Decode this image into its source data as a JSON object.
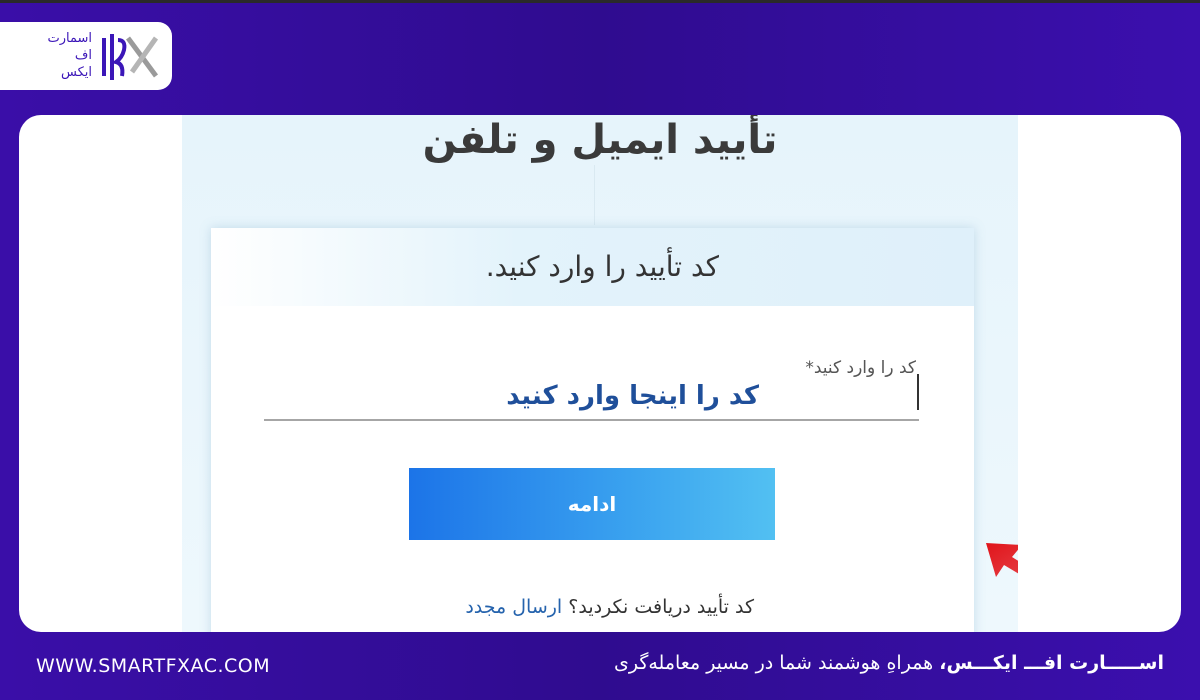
{
  "brand": {
    "logo_lines": [
      "اسمارت",
      "اف",
      "ایکس"
    ],
    "accent": "#3b16b8",
    "background": "#34109c"
  },
  "screenshot": {
    "page_title": "تأیید ایمیل و تلفن",
    "dialog": {
      "title": "کد تأیید را وارد کنید.",
      "field_label": "کد را وارد کنید*",
      "field_value": "کد را اینجا وارد کنید",
      "continue_label": "ادامه",
      "resend_prompt": "کد تأیید دریافت نکردید؟",
      "resend_link": "ارسال مجدد"
    },
    "annotation": "red-arrow-icon"
  },
  "footer": {
    "url": "WWW.SMARTFXAC.COM",
    "slogan_brand": "اســـــارت افـــ ایکـــس،",
    "slogan_rest": " همراهِ هوشمند شما در مسیر معامله‌گری"
  }
}
